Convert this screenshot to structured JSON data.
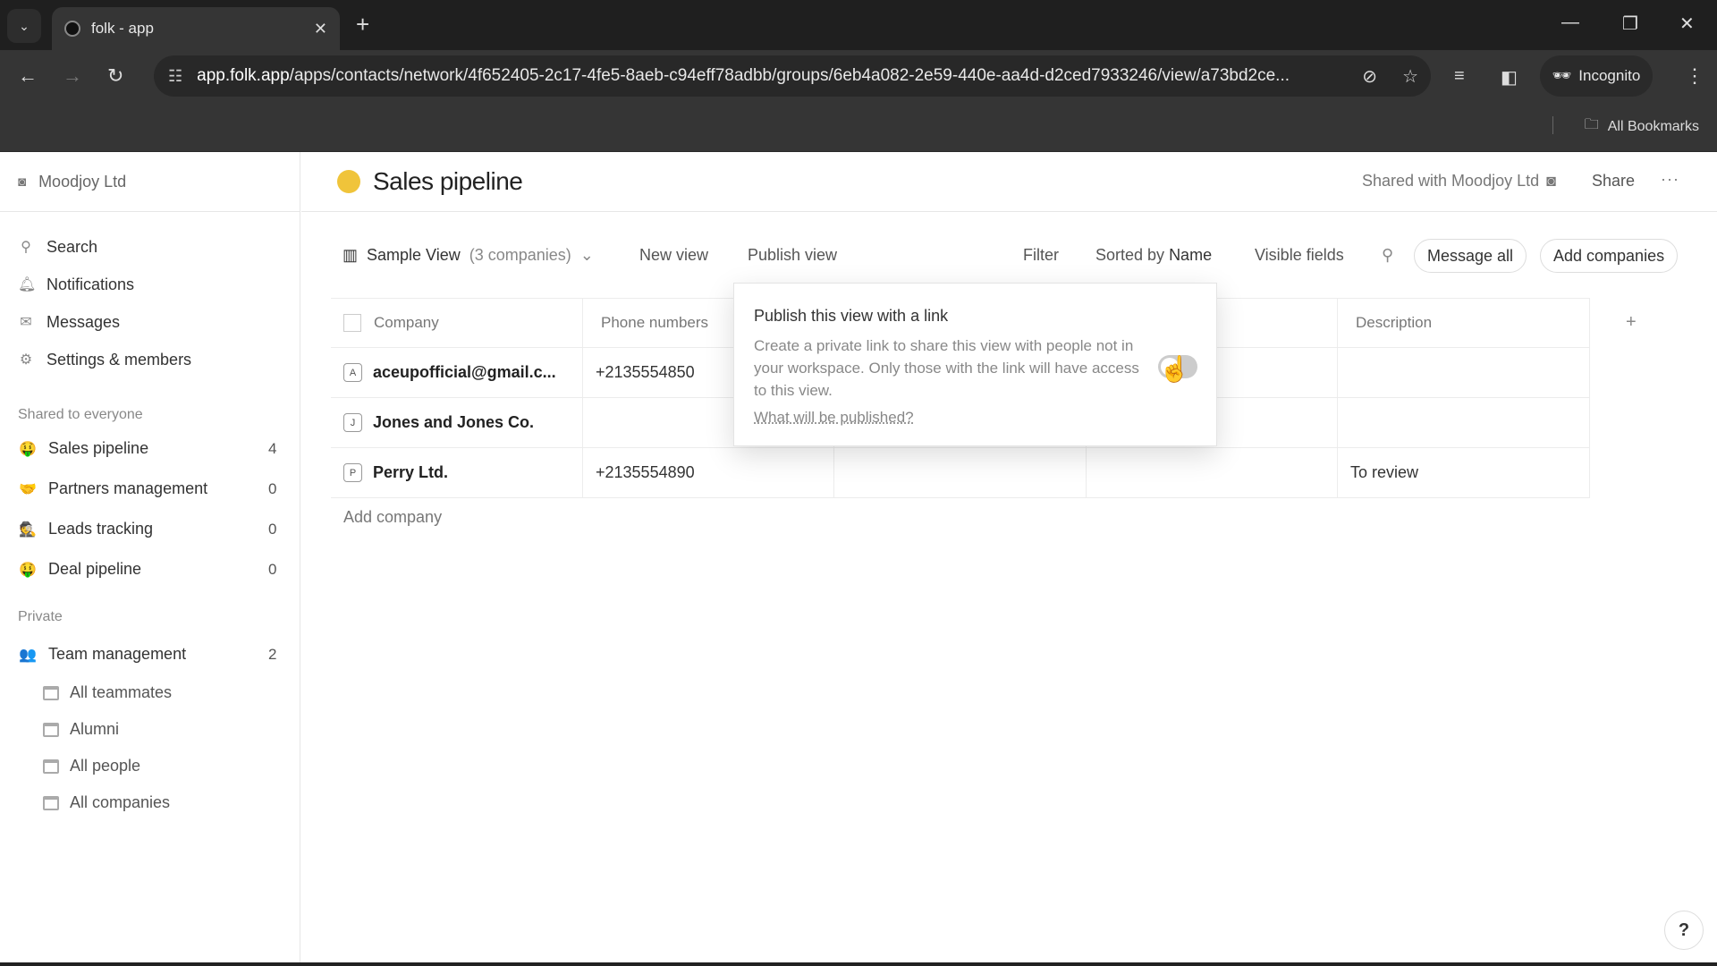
{
  "browser": {
    "tab_title": "folk - app",
    "url_host": "app.folk.app",
    "url_path": "/apps/contacts/network/4f652405-2c17-4fe5-8aeb-c94eff78adbb/groups/6eb4a082-2e59-440e-aa4d-d2ced7933246/view/a73bd2ce...",
    "incognito_label": "Incognito",
    "bookmarks_label": "All Bookmarks"
  },
  "sidebar": {
    "workspace": "Moodjoy Ltd",
    "nav": [
      {
        "label": "Search",
        "icon": "search-icon"
      },
      {
        "label": "Notifications",
        "icon": "bell-icon"
      },
      {
        "label": "Messages",
        "icon": "mail-icon"
      },
      {
        "label": "Settings & members",
        "icon": "gear-icon"
      }
    ],
    "shared_section": "Shared to everyone",
    "shared_groups": [
      {
        "label": "Sales pipeline",
        "count": "4",
        "emoji": "🤑"
      },
      {
        "label": "Partners management",
        "count": "0",
        "emoji": "🤝"
      },
      {
        "label": "Leads tracking",
        "count": "0",
        "emoji": "🕵"
      },
      {
        "label": "Deal pipeline",
        "count": "0",
        "emoji": "🤑"
      }
    ],
    "private_section": "Private",
    "private_groups": [
      {
        "label": "Team management",
        "count": "2",
        "emoji": "👥"
      }
    ],
    "private_views": [
      "All teammates",
      "Alumni",
      "All people",
      "All companies"
    ]
  },
  "header": {
    "title": "Sales pipeline",
    "emoji": "🤑",
    "shared_with": "Shared with Moodjoy Ltd",
    "share": "Share",
    "more": "···"
  },
  "toolbar": {
    "view_name": "Sample View",
    "view_count": "(3 companies)",
    "new_view": "New view",
    "publish_view": "Publish view",
    "filter": "Filter",
    "sorted_prefix": "Sorted by",
    "sorted_field": "Name",
    "visible_fields": "Visible fields",
    "message_all": "Message all",
    "add_companies": "Add companies"
  },
  "table": {
    "columns": [
      "Company",
      "Phone numbers",
      "",
      "",
      "Description"
    ],
    "rows": [
      {
        "letter": "A",
        "company": "aceupofficial@gmail.c...",
        "phone": "+2135554850",
        "description": ""
      },
      {
        "letter": "J",
        "company": "Jones and Jones Co.",
        "phone": "",
        "description": ""
      },
      {
        "letter": "P",
        "company": "Perry Ltd.",
        "phone": "+2135554890",
        "description": "To review"
      }
    ],
    "add_company": "Add company",
    "add_column": "+"
  },
  "popover": {
    "title": "Publish this view with a link",
    "description": "Create a private link to share this view with people not in your workspace. Only those with the link will have access to this view.",
    "link": "What will be published?",
    "toggle_on": false
  },
  "help": "?"
}
